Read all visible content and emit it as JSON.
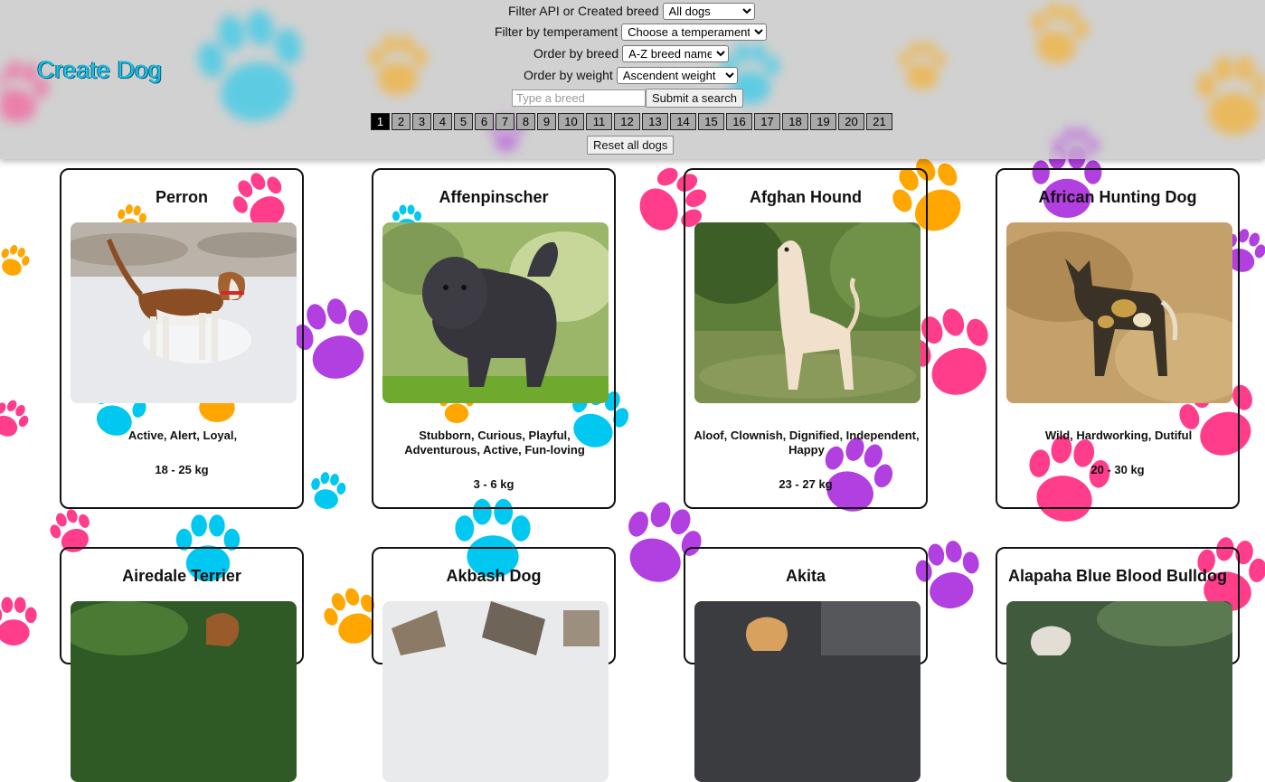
{
  "header": {
    "create_link": "Create Dog",
    "filter_source_label": "Filter API or Created breed",
    "filter_source_value": "All dogs",
    "filter_temperament_label": "Filter by temperament",
    "filter_temperament_value": "Choose a temperament",
    "order_breed_label": "Order by breed",
    "order_breed_value": "A-Z breed name",
    "order_weight_label": "Order by weight",
    "order_weight_value": "Ascendent weight",
    "search_placeholder": "Type a breed",
    "search_button": "Submit a search",
    "reset_button": "Reset all dogs"
  },
  "pagination": {
    "current": 1,
    "pages": [
      "1",
      "2",
      "3",
      "4",
      "5",
      "6",
      "7",
      "8",
      "9",
      "10",
      "11",
      "12",
      "13",
      "14",
      "15",
      "16",
      "17",
      "18",
      "19",
      "20",
      "21"
    ]
  },
  "cards": [
    {
      "name": "Perron",
      "temperament": "Active, Alert, Loyal,",
      "weight": "18 - 25 kg"
    },
    {
      "name": "Affenpinscher",
      "temperament": "Stubborn, Curious, Playful, Adventurous, Active, Fun-loving",
      "weight": "3 - 6 kg"
    },
    {
      "name": "Afghan Hound",
      "temperament": "Aloof, Clownish, Dignified, Independent, Happy",
      "weight": "23 - 27 kg"
    },
    {
      "name": "African Hunting Dog",
      "temperament": "Wild, Hardworking, Dutiful",
      "weight": "20 - 30 kg"
    },
    {
      "name": "Airedale Terrier"
    },
    {
      "name": "Akbash Dog"
    },
    {
      "name": "Akita"
    },
    {
      "name": "Alapaha Blue Blood Bulldog"
    }
  ],
  "colors": {
    "accent": "#17c3e8",
    "paw_pink": "#ff3d8b",
    "paw_purple": "#b23fe0",
    "paw_cyan": "#00c8f0",
    "paw_orange": "#ffa600",
    "active_page": "#000000"
  }
}
